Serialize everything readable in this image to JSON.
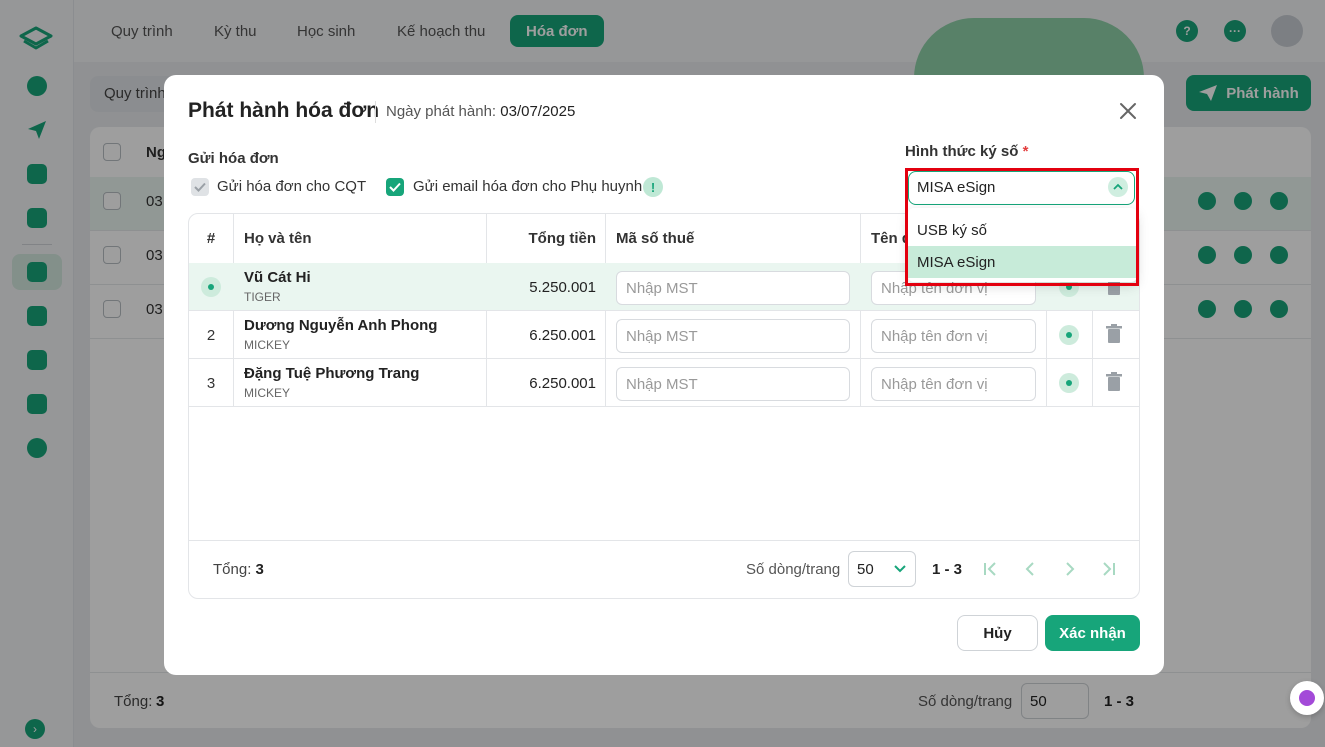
{
  "topnav": {
    "tabs": [
      {
        "label": "Quy trình"
      },
      {
        "label": "Kỳ thu"
      },
      {
        "label": "Học sinh"
      },
      {
        "label": "Kế hoạch thu"
      },
      {
        "label": "Hóa đơn",
        "active": true
      }
    ]
  },
  "icons": {
    "help": "help-icon",
    "more": "more-icon",
    "avatar": "user-avatar-icon",
    "sidebar": [
      "logo-icon",
      "pie-chart-icon",
      "send-icon",
      "folder-icon",
      "heart-icon",
      "chart-icon",
      "wallet-icon",
      "briefcase-icon",
      "report-icon",
      "settings-icon"
    ]
  },
  "help_symbol": "?",
  "more_symbol": "···",
  "background": {
    "filter_label": "Quy trình",
    "publish_label": "Phát hành",
    "header_col": "Ng",
    "rows": [
      {
        "date": "03"
      },
      {
        "date": "03"
      },
      {
        "date": "03"
      }
    ],
    "total_label": "Tổng:",
    "total_value": "3",
    "rows_per_page_label": "Số dòng/trang",
    "page_size": "50",
    "range": "1 - 3"
  },
  "modal": {
    "title": "Phát hành hóa đơn",
    "issue_date_label": "Ngày phát hành:",
    "issue_date": "03/07/2025",
    "send_section_label": "Gửi hóa đơn",
    "send_cqt_label": "Gửi hóa đơn cho CQT",
    "send_cqt_checked": true,
    "send_cqt_disabled": true,
    "send_email_label": "Gửi email hóa đơn cho Phụ huynh",
    "send_email_checked": true,
    "info_symbol": "!",
    "sign_label": "Hình thức ký số",
    "required_mark": "*",
    "sign_value": "MISA eSign",
    "sign_options": [
      {
        "label": "USB ký số"
      },
      {
        "label": "MISA eSign",
        "selected": true
      }
    ],
    "table": {
      "headers": {
        "idx": "#",
        "name": "Họ và tên",
        "amount": "Tổng tiền",
        "tax_code": "Mã số thuế",
        "unit": "Tên đơn vị"
      },
      "rows": [
        {
          "idx": "",
          "name": "Vũ Cát Hi",
          "class": "TIGER",
          "amount": "5.250.001",
          "tax_placeholder": "Nhập MST",
          "unit_placeholder": "Nhập tên đơn vị"
        },
        {
          "idx": "2",
          "name": "Dương Nguyễn Anh Phong",
          "class": "MICKEY",
          "amount": "6.250.001",
          "tax_placeholder": "Nhập MST",
          "unit_placeholder": "Nhập tên đơn vị"
        },
        {
          "idx": "3",
          "name": "Đặng Tuệ Phương Trang",
          "class": "MICKEY",
          "amount": "6.250.001",
          "tax_placeholder": "Nhập MST",
          "unit_placeholder": "Nhập tên đơn vị"
        }
      ],
      "total_label": "Tổng:",
      "total_value": "3",
      "rows_per_page_label": "Số dòng/trang",
      "page_size": "50",
      "range": "1 - 3"
    },
    "cancel_label": "Hủy",
    "confirm_label": "Xác nhận"
  },
  "colors": {
    "accent": "#17a57a",
    "highlight_row": "#eaf6f0",
    "annotation_box": "#e3000f"
  }
}
